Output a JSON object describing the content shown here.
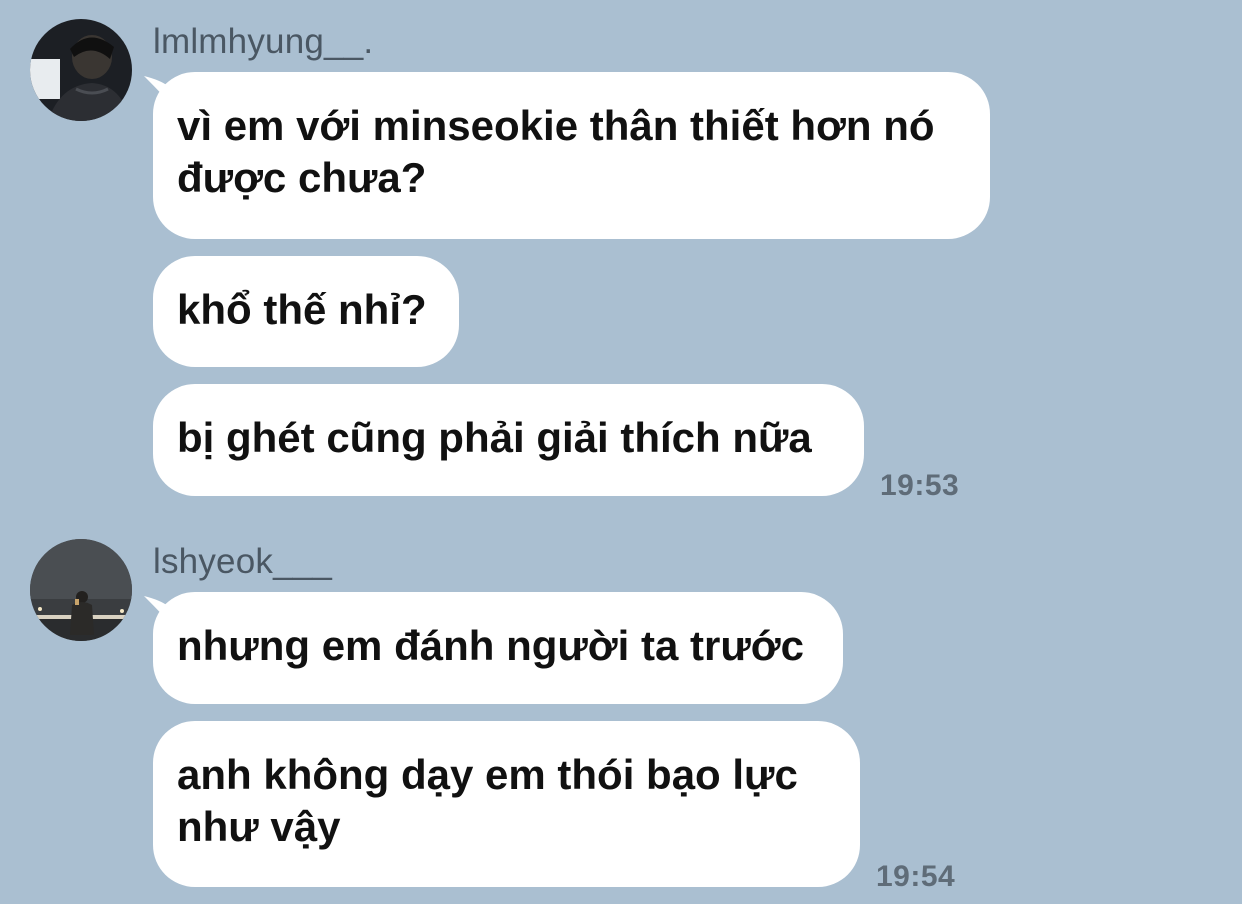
{
  "conversation": {
    "groups": [
      {
        "sender": "lmlmhyung__.",
        "avatar_icon": "avatar-photo-dark-jacket",
        "messages": [
          "vì em với minseokie thân thiết hơn nó\nđược chưa?",
          "khổ thế nhỉ?",
          "bị ghét cũng phải giải thích nữa"
        ],
        "time": "19:53"
      },
      {
        "sender": "lshyeok___",
        "avatar_icon": "avatar-photo-night-street",
        "messages": [
          "nhưng em đánh người ta trước",
          "anh không dạy em thói bạo lực\nnhư vậy"
        ],
        "time": "19:54"
      }
    ]
  },
  "colors": {
    "background": "#aabfd1",
    "bubble": "#ffffff",
    "text": "#111111",
    "sender": "#4a5763",
    "time": "#5f6c78"
  }
}
